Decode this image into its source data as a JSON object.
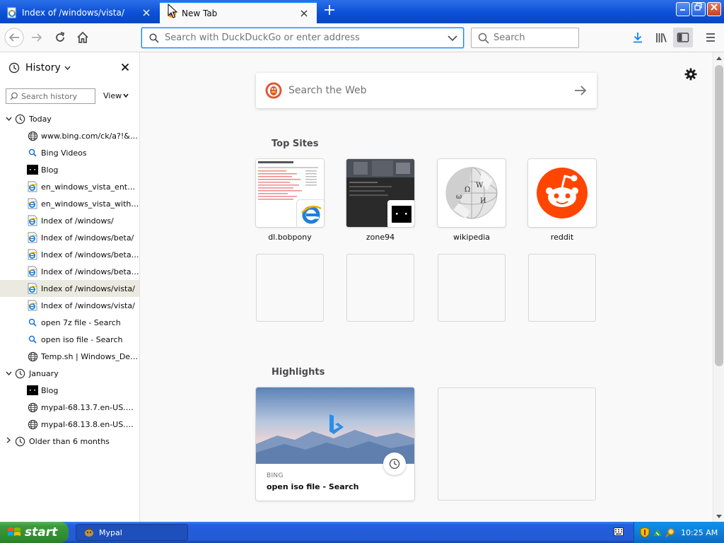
{
  "tabs": [
    {
      "label": "Index of /windows/vista/",
      "active": false,
      "icon": "ie-page-icon"
    },
    {
      "label": "New Tab",
      "active": true,
      "icon": "firefox-icon"
    }
  ],
  "window_controls": [
    "minimize",
    "maximize",
    "close"
  ],
  "navbar": {
    "url_placeholder": "Search with DuckDuckGo or enter address",
    "search_placeholder": "Search"
  },
  "sidebar": {
    "title": "History",
    "search_placeholder": "Search history",
    "view_label": "View",
    "folders": [
      {
        "label": "Today",
        "expanded": true,
        "items": [
          {
            "label": "www.bing.com/ck/a?!&&p...",
            "icon": "globe-icon"
          },
          {
            "label": "Bing Videos",
            "icon": "search-icon"
          },
          {
            "label": "Blog",
            "icon": "zone-icon"
          },
          {
            "label": "en_windows_vista_enterp...",
            "icon": "ie-page-icon"
          },
          {
            "label": "en_windows_vista_with_s...",
            "icon": "ie-page-icon"
          },
          {
            "label": "Index of /windows/",
            "icon": "ie-page-icon"
          },
          {
            "label": "Index of /windows/beta/",
            "icon": "ie-page-icon"
          },
          {
            "label": "Index of /windows/beta/lo...",
            "icon": "ie-page-icon"
          },
          {
            "label": "Index of /windows/beta/lo...",
            "icon": "ie-page-icon"
          },
          {
            "label": "Index of /windows/vista/",
            "icon": "ie-page-icon",
            "selected": true
          },
          {
            "label": "Index of /windows/vista/",
            "icon": "ie-page-icon"
          },
          {
            "label": "open 7z file - Search",
            "icon": "search-icon"
          },
          {
            "label": "open iso file - Search",
            "icon": "search-icon"
          },
          {
            "label": "Temp.sh | Windows_Defe...",
            "icon": "globe-icon"
          }
        ]
      },
      {
        "label": "January",
        "expanded": true,
        "items": [
          {
            "label": "Blog",
            "icon": "zone-icon"
          },
          {
            "label": "mypal-68.13.7.en-US.win...",
            "icon": "globe-icon"
          },
          {
            "label": "mypal-68.13.8.en-US.win...",
            "icon": "globe-icon"
          }
        ]
      },
      {
        "label": "Older than 6 months",
        "expanded": false,
        "items": []
      }
    ]
  },
  "newtab": {
    "web_search_placeholder": "Search the Web",
    "top_sites_title": "Top Sites",
    "top_sites": [
      {
        "label": "dl.bobpony",
        "kind": "bobpony"
      },
      {
        "label": "zone94",
        "kind": "zone94"
      },
      {
        "label": "wikipedia",
        "kind": "wikipedia"
      },
      {
        "label": "reddit",
        "kind": "reddit"
      }
    ],
    "highlights_title": "Highlights",
    "highlights": [
      {
        "source": "BING",
        "title": "open iso file - Search"
      }
    ]
  },
  "taskbar": {
    "start_label": "start",
    "tasks": [
      {
        "label": "Mypal"
      }
    ],
    "clock": "10:25 AM"
  },
  "colors": {
    "accent": "#0a84ff",
    "taskbar": "#245edb",
    "start_green": "#3c9a3a",
    "reddit": "#ff4500",
    "duckduckgo": "#de5833"
  }
}
